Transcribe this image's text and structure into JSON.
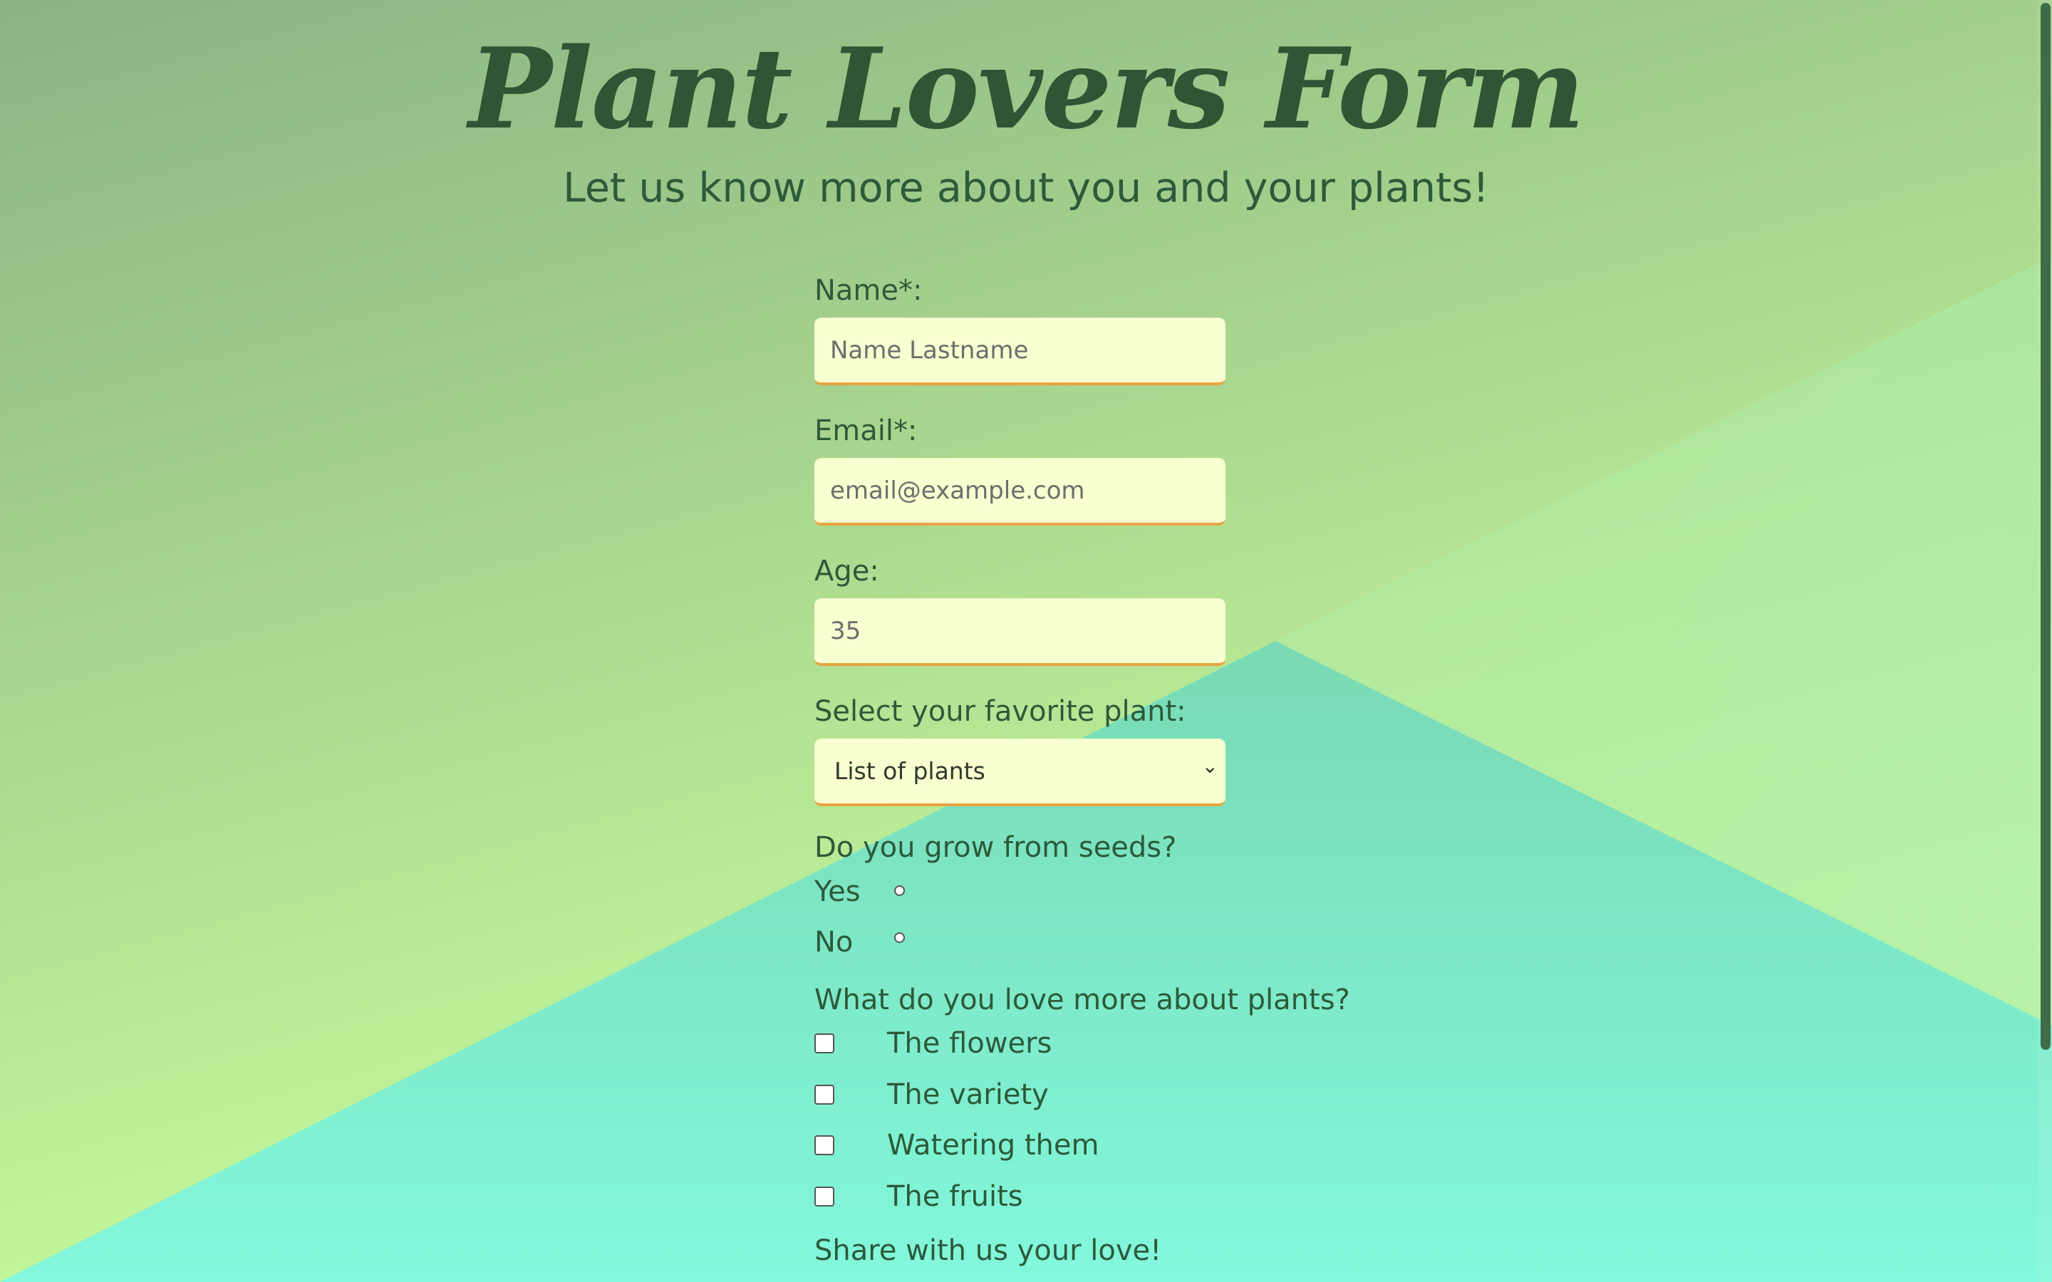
{
  "header": {
    "title": "Plant Lovers Form",
    "subtitle": "Let us know more about you and your plants!"
  },
  "form": {
    "name": {
      "label": "Name*:",
      "placeholder": "Name Lastname"
    },
    "email": {
      "label": "Email*:",
      "placeholder": "email@example.com"
    },
    "age": {
      "label": "Age:",
      "placeholder": "35"
    },
    "plant": {
      "label": "Select your favorite plant:",
      "selected": "List of plants"
    },
    "seeds": {
      "question": "Do you grow from seeds?",
      "options": [
        "Yes",
        "No"
      ]
    },
    "love": {
      "question": "What do you love more about plants?",
      "options": [
        "The flowers",
        "The variety",
        "Watering them",
        "The fruits"
      ]
    },
    "share": {
      "label": "Share with us your love!"
    }
  },
  "colors": {
    "text": "#2d5a3a",
    "field_bg": "#f8ffd0",
    "field_border": "#e8a441",
    "bg_top": "#8cb484",
    "bg_bottom_left": "#d4ff96",
    "bg_teal": "#7ff5d8"
  }
}
